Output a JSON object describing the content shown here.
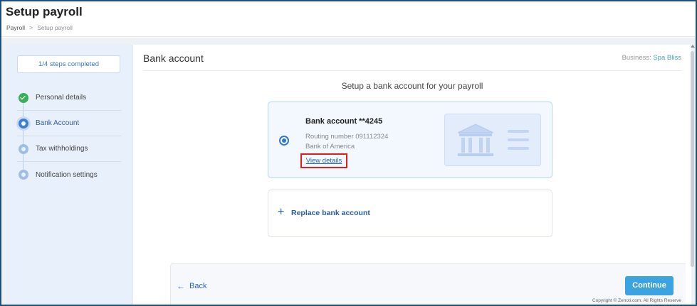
{
  "header": {
    "title": "Setup payroll",
    "breadcrumb": {
      "root": "Payroll",
      "separator": ">",
      "current": "Setup payroll"
    }
  },
  "sidebar": {
    "progress": "1/4 steps completed",
    "steps": [
      {
        "label": "Personal details",
        "status": "done"
      },
      {
        "label": "Bank Account",
        "status": "active"
      },
      {
        "label": "Tax withholdings",
        "status": "pending"
      },
      {
        "label": "Notification settings",
        "status": "pending"
      }
    ]
  },
  "main": {
    "title": "Bank account",
    "business_label": "Business:",
    "business_name": "Spa Bliss",
    "section_title": "Setup a bank account for your payroll",
    "bank_card": {
      "account_name": "Bank account **4245",
      "routing": "Routing number 091112324",
      "bank_name": "Bank of America",
      "view_details": "View details",
      "icon": "bank-building-icon"
    },
    "replace": {
      "plus": "+",
      "label": "Replace bank account"
    },
    "footer": {
      "back_label": "Back",
      "back_icon": "arrow-left-icon",
      "continue_label": "Continue",
      "copyright": "Copyright © Zenoti.com. All Rights Reserve"
    }
  },
  "colors": {
    "accent": "#2f78cf",
    "continue": "#3aa3e0",
    "done": "#3aaf5a",
    "highlight_box": "#e01e1e"
  }
}
